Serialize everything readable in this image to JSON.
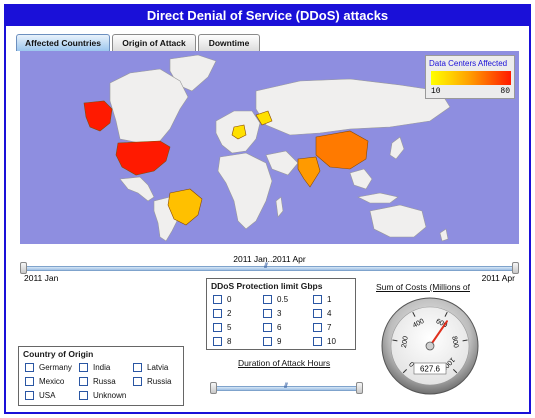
{
  "title": "Direct Denial of Service (DDoS) attacks",
  "tabs": [
    "Affected Countries",
    "Origin of Attack",
    "Downtime"
  ],
  "active_tab": "Affected Countries",
  "map": {
    "legend_title": "Data Centers Affected",
    "legend_min": "10",
    "legend_max": "80",
    "scale_colors": [
      "#ffff00",
      "#ffd000",
      "#ff9a00",
      "#ff5a00",
      "#ff1a00"
    ],
    "ocean_color": "#8e8ee0",
    "land_color": "#f0efee",
    "highlighted": [
      {
        "country": "Alaska (USA)",
        "color": "#ff1a00"
      },
      {
        "country": "USA",
        "color": "#ff1a00"
      },
      {
        "country": "China",
        "color": "#ff7a00"
      },
      {
        "country": "India",
        "color": "#ff9a00"
      },
      {
        "country": "Brazil",
        "color": "#ffc000"
      },
      {
        "country": "Germany",
        "color": "#ffe000"
      },
      {
        "country": "Russia",
        "color": "#ffe000"
      }
    ]
  },
  "time_range": {
    "caption": "2011 Jan..2011 Apr",
    "start_label": "2011 Jan",
    "end_label": "2011 Apr"
  },
  "country_filter": {
    "title": "Country of Origin",
    "options": [
      "Germany",
      "India",
      "Latvia",
      "Mexico",
      "Russa",
      "Russia",
      "USA",
      "Unknown"
    ]
  },
  "protection_filter": {
    "title": "DDoS Protection limit Gbps",
    "options": [
      "0",
      "0.5",
      "1",
      "2",
      "3",
      "4",
      "5",
      "6",
      "7",
      "8",
      "9",
      "10"
    ]
  },
  "duration": {
    "title": "Duration of Attack Hours"
  },
  "gauge": {
    "title": "Sum of Costs (Millions of",
    "value": 627.6,
    "value_text": "627.6",
    "min": 0,
    "max": 1000,
    "ticks": [
      "0",
      "200",
      "400",
      "600",
      "800",
      "1000"
    ]
  }
}
